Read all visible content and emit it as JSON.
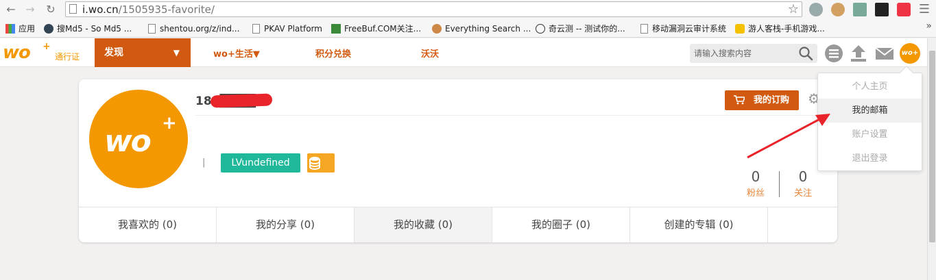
{
  "browser": {
    "url_domain": "i.wo.cn",
    "url_path": "/1505935-favorite/",
    "bookmarks": [
      {
        "label": "应用"
      },
      {
        "label": "搜Md5 - So Md5 ..."
      },
      {
        "label": "shentou.org/z/ind..."
      },
      {
        "label": "PKAV Platform"
      },
      {
        "label": "FreeBuf.COM关注..."
      },
      {
        "label": "Everything Search ..."
      },
      {
        "label": "奇云测 -- 测试你的..."
      },
      {
        "label": "移动漏洞云审计系统"
      },
      {
        "label": "游人客栈-手机游戏..."
      }
    ],
    "more_label": "»"
  },
  "header": {
    "logo_text": "wo",
    "logo_sub": "通行证",
    "discover_label": "发现",
    "nav": [
      "wo+生活▼",
      "积分兑换",
      "沃沃"
    ],
    "search_placeholder": "请输入搜索内容"
  },
  "profile": {
    "username": "186████8",
    "level_label": "LVundefined",
    "order_label": "我的订购",
    "stats": [
      {
        "value": "0",
        "label": "粉丝"
      },
      {
        "value": "0",
        "label": "关注"
      }
    ],
    "tabs": [
      {
        "label": "我喜欢的  (0)"
      },
      {
        "label": "我的分享 (0)"
      },
      {
        "label": "我的收藏  (0)"
      },
      {
        "label": "我的圈子 (0)"
      },
      {
        "label": "创建的专辑  (0)"
      }
    ]
  },
  "dropdown": {
    "items": [
      "个人主页",
      "我的邮箱",
      "账户设置",
      "退出登录"
    ]
  },
  "colors": {
    "brand_orange": "#f39800",
    "nav_active": "#d25a10",
    "level_green": "#1fb89a"
  }
}
